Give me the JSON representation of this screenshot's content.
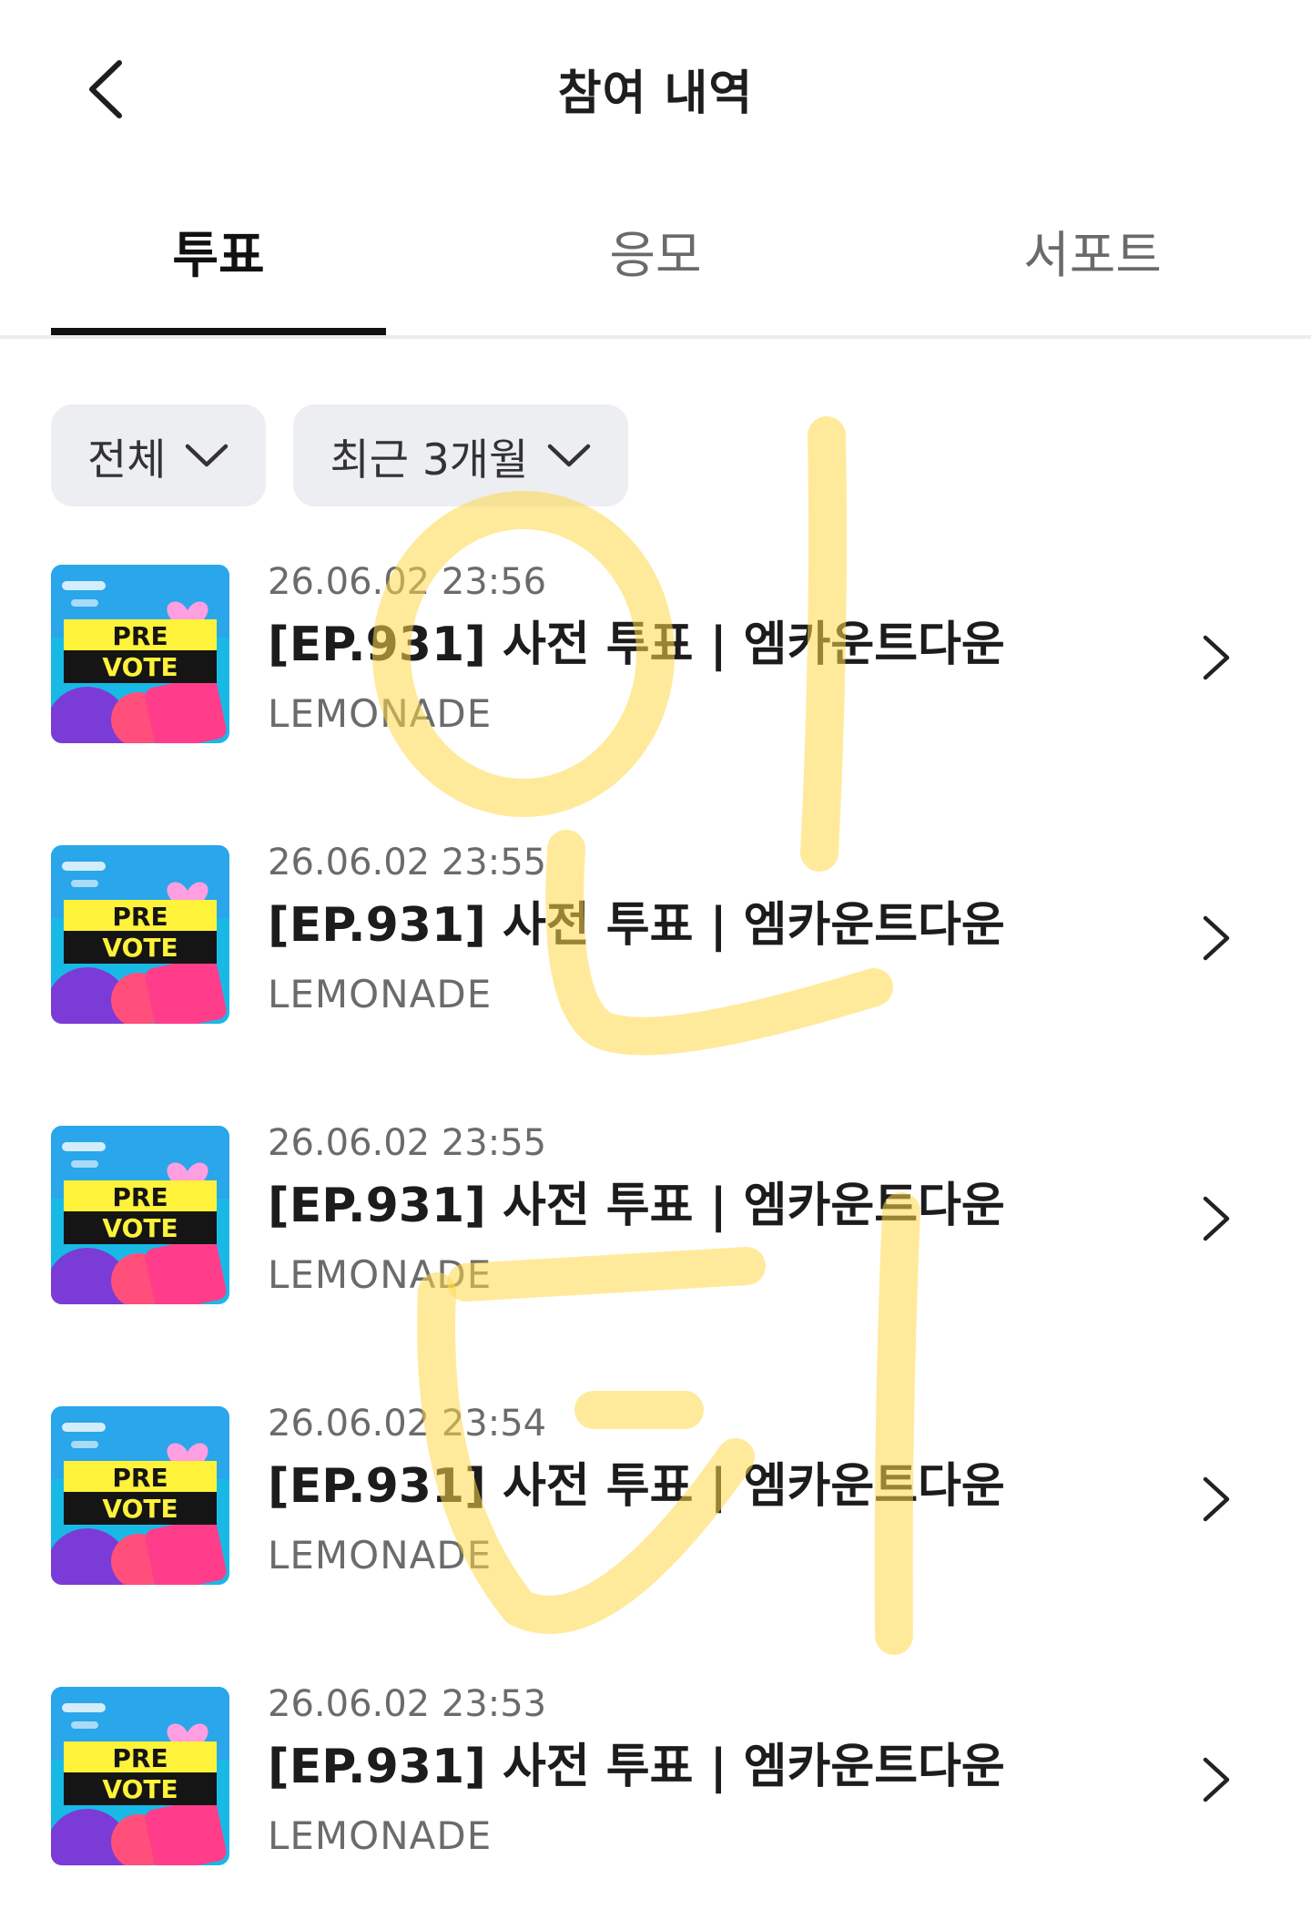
{
  "header": {
    "title": "참여 내역",
    "back_icon": "chevron-left-icon"
  },
  "tabs": [
    {
      "label": "투표",
      "active": true
    },
    {
      "label": "응모",
      "active": false
    },
    {
      "label": "서포트",
      "active": false
    }
  ],
  "filters": [
    {
      "label": "전체",
      "icon": "chevron-down-icon"
    },
    {
      "label": "최근 3개월",
      "icon": "chevron-down-icon"
    }
  ],
  "items": [
    {
      "date": "26.06.02 23:56",
      "title": "[EP.931] 사전 투표 | 엠카운트다운",
      "source": "LEMONADE"
    },
    {
      "date": "26.06.02 23:55",
      "title": "[EP.931] 사전 투표 | 엠카운트다운",
      "source": "LEMONADE"
    },
    {
      "date": "26.06.02 23:55",
      "title": "[EP.931] 사전 투표 | 엠카운트다운",
      "source": "LEMONADE"
    },
    {
      "date": "26.06.02 23:54",
      "title": "[EP.931] 사전 투표 | 엠카운트다운",
      "source": "LEMONADE"
    },
    {
      "date": "26.06.02 23:53",
      "title": "[EP.931] 사전 투표 | 엠카운트다운",
      "source": "LEMONADE"
    }
  ],
  "thumbnail": {
    "line1": "PRE",
    "line2": "VOTE"
  },
  "watermark": {
    "text": "인티",
    "color": "#ffd84a"
  },
  "colors": {
    "accent": "#111111",
    "chip_bg": "#eceef1",
    "muted_text": "#6b6b6b"
  }
}
